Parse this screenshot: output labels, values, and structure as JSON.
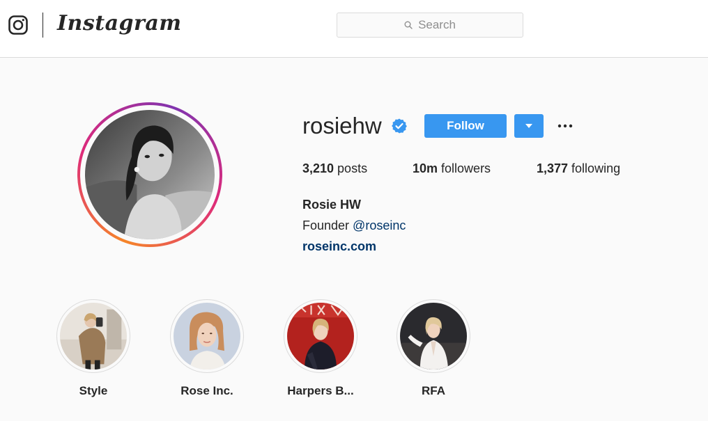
{
  "header": {
    "brand": "Instagram",
    "search": {
      "placeholder": "Search"
    }
  },
  "profile": {
    "username": "rosiehw",
    "verified": true,
    "follow_label": "Follow",
    "more_label": "•••",
    "stats": [
      {
        "count": "3,210",
        "label": " posts"
      },
      {
        "count": "10m",
        "label": " followers"
      },
      {
        "count": "1,377",
        "label": " following"
      }
    ],
    "full_name": "Rosie HW",
    "bio_prefix": "Founder ",
    "bio_mention": "@roseinc",
    "website": "roseinc.com"
  },
  "highlights": [
    {
      "label": "Style"
    },
    {
      "label": "Rose Inc."
    },
    {
      "label": "Harpers B..."
    },
    {
      "label": "RFA"
    }
  ],
  "colors": {
    "accent_blue": "#3897f0",
    "link_navy": "#003569",
    "verified_blue": "#3897f0"
  },
  "icons": {
    "logo": "instagram-camera-icon",
    "search": "search-icon",
    "verified": "verified-badge-icon",
    "dropdown": "caret-down-icon",
    "more": "more-horizontal-icon"
  }
}
